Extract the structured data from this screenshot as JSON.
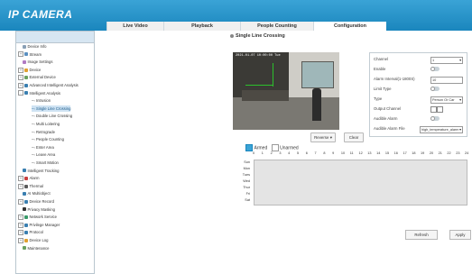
{
  "app": {
    "title": "IP CAMERA"
  },
  "tabs": [
    {
      "label": "Live Video"
    },
    {
      "label": "Playback"
    },
    {
      "label": "People Counting"
    },
    {
      "label": "Configuration"
    }
  ],
  "sidebar": {
    "items": [
      {
        "label": "Device Info",
        "level": 0,
        "exp": "",
        "icon": "#8aa0b6"
      },
      {
        "label": "Stream",
        "level": 0,
        "exp": "+",
        "icon": "#5a8fc0"
      },
      {
        "label": "Image Settings",
        "level": 0,
        "exp": "",
        "icon": "#b07ac4"
      },
      {
        "label": "Device",
        "level": 0,
        "exp": "+",
        "icon": "#e0a030"
      },
      {
        "label": "External Device",
        "level": 0,
        "exp": "+",
        "icon": "#6aa060"
      },
      {
        "label": "Advanced Intelligent Analysis",
        "level": 0,
        "exp": "+",
        "icon": "#3a7fb0"
      },
      {
        "label": "Intelligent Analysis",
        "level": 0,
        "exp": "-",
        "icon": "#3a7fb0"
      },
      {
        "label": "Intrusion",
        "level": 1,
        "exp": "",
        "icon": ""
      },
      {
        "label": "Single Line Crossing",
        "level": 1,
        "exp": "",
        "icon": "",
        "selected": true
      },
      {
        "label": "Double Line Crossing",
        "level": 1,
        "exp": "",
        "icon": ""
      },
      {
        "label": "Multi Loitering",
        "level": 1,
        "exp": "",
        "icon": ""
      },
      {
        "label": "Retrograde",
        "level": 1,
        "exp": "",
        "icon": ""
      },
      {
        "label": "People Counting",
        "level": 1,
        "exp": "",
        "icon": ""
      },
      {
        "label": "Enter Area",
        "level": 1,
        "exp": "",
        "icon": ""
      },
      {
        "label": "Leave Area",
        "level": 1,
        "exp": "",
        "icon": ""
      },
      {
        "label": "Smart Motion",
        "level": 1,
        "exp": "",
        "icon": ""
      },
      {
        "label": "Intelligent Tracking",
        "level": 0,
        "exp": "",
        "icon": "#3a7fb0"
      },
      {
        "label": "Alarm",
        "level": 0,
        "exp": "+",
        "icon": "#c94040"
      },
      {
        "label": "Thermal",
        "level": 0,
        "exp": "+",
        "icon": "#5a5a5a"
      },
      {
        "label": "AI Multiobject",
        "level": 0,
        "exp": "",
        "icon": "#3a7fb0"
      },
      {
        "label": "Device Record",
        "level": 0,
        "exp": "+",
        "icon": "#3a7fb0"
      },
      {
        "label": "Privacy Masking",
        "level": 0,
        "exp": "",
        "icon": "#333333"
      },
      {
        "label": "Network Service",
        "level": 0,
        "exp": "+",
        "icon": "#3a9a6a"
      },
      {
        "label": "Privilege Manager",
        "level": 0,
        "exp": "+",
        "icon": "#3a7fb0"
      },
      {
        "label": "Protocol",
        "level": 0,
        "exp": "+",
        "icon": "#3a7fb0"
      },
      {
        "label": "Device Log",
        "level": 0,
        "exp": "+",
        "icon": "#e0a030"
      },
      {
        "label": "Maintenance",
        "level": 0,
        "exp": "",
        "icon": "#6aa060"
      }
    ]
  },
  "main": {
    "title": "Single Line Crossing"
  },
  "camera": {
    "osd": "2021-01-07 10:00:00 Tue"
  },
  "video_controls": {
    "direction_value": "Reverse",
    "clear_label": "Clear"
  },
  "config": {
    "channel": {
      "label": "Channel",
      "value": "1"
    },
    "enable": {
      "label": "Enable",
      "value": ""
    },
    "alarm_interval": {
      "label": "Alarm Interval(1-1800S)",
      "value": "10"
    },
    "limit_type": {
      "label": "Limit Type",
      "value": ""
    },
    "type": {
      "label": "Type",
      "value": "Person Or Car"
    },
    "output_channel": {
      "label": "Output Channel",
      "value": ""
    },
    "audible_alarm": {
      "label": "Audible Alarm",
      "value": ""
    },
    "audible_alarm_file": {
      "label": "Audible Alarm File",
      "value": "high_temperature_alarm"
    }
  },
  "schedule": {
    "armed_label": "Armed",
    "unarmed_label": "Unarmed",
    "hours": [
      "0",
      "1",
      "2",
      "3",
      "4",
      "5",
      "6",
      "7",
      "8",
      "9",
      "10",
      "11",
      "12",
      "13",
      "14",
      "15",
      "16",
      "17",
      "18",
      "19",
      "20",
      "21",
      "22",
      "23",
      "24"
    ],
    "days": [
      "Sun",
      "Mon",
      "Tues",
      "Wed",
      "Thur",
      "Fri",
      "Sat"
    ]
  },
  "actions": {
    "refresh_label": "Refresh",
    "apply_label": "Apply"
  },
  "colors": {
    "accent": "#1d8ec3",
    "armed": "#3aa3d6",
    "selected": "#cfe3f3"
  }
}
